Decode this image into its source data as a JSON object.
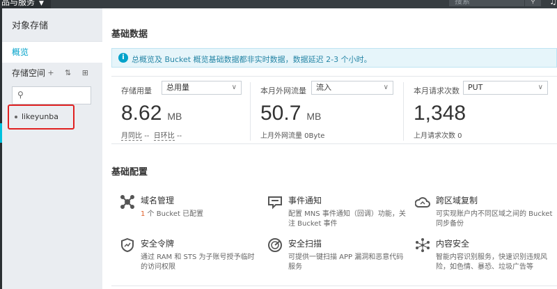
{
  "topbar": {
    "product_menu": "品与服务",
    "search_placeholder": "搜索",
    "search_button_icon": "search-icon",
    "notification_icon": "bell-icon"
  },
  "sidebar": {
    "title": "对象存储",
    "overview": "概览",
    "storage_space": "存储空间",
    "tools": "+ ⇅ ⊞",
    "search_icon": "search-icon",
    "bucket": "likeyunba"
  },
  "main": {
    "basic_data_title": "基础数据",
    "notice": "总概览及 Bucket 概览基础数据都非实时数据，数据延迟 2-3 个小时。",
    "stats": [
      {
        "label": "存储用量",
        "select": "总用量",
        "value": "8.62",
        "unit": "MB",
        "sub_a": "月同比",
        "sub_a_val": "--",
        "sub_b": "日环比",
        "sub_b_val": "--"
      },
      {
        "label": "本月外网流量",
        "select": "流入",
        "value": "50.7",
        "unit": "MB",
        "sub": "上月外网流量 0Byte"
      },
      {
        "label": "本月请求次数",
        "select": "PUT",
        "value": "1,348",
        "unit": "",
        "sub": "上月请求次数 0"
      }
    ],
    "basic_config_title": "基础配置",
    "features": [
      {
        "icon": "domain-icon",
        "title": "域名管理",
        "count": "1",
        "desc": " 个 Bucket 已配置"
      },
      {
        "icon": "event-icon",
        "title": "事件通知",
        "desc": "配置 MNS 事件通知（回调）功能，关注 Bucket 事件"
      },
      {
        "icon": "cloud-icon",
        "title": "跨区域复制",
        "desc": "可实现账户内不同区域之间的 Bucket 同步备份"
      },
      {
        "icon": "shield-icon",
        "title": "安全令牌",
        "desc": "通过 RAM 和 STS 为子账号授予临时的访问权限"
      },
      {
        "icon": "scan-icon",
        "title": "安全扫描",
        "desc": "可提供一键扫描 APP 漏洞和恶意代码服务"
      },
      {
        "icon": "content-security-icon",
        "title": "内容安全",
        "desc": "智能内容识别服务，快速识别违规风险，如色情、暴恐、垃圾广告等"
      }
    ]
  }
}
